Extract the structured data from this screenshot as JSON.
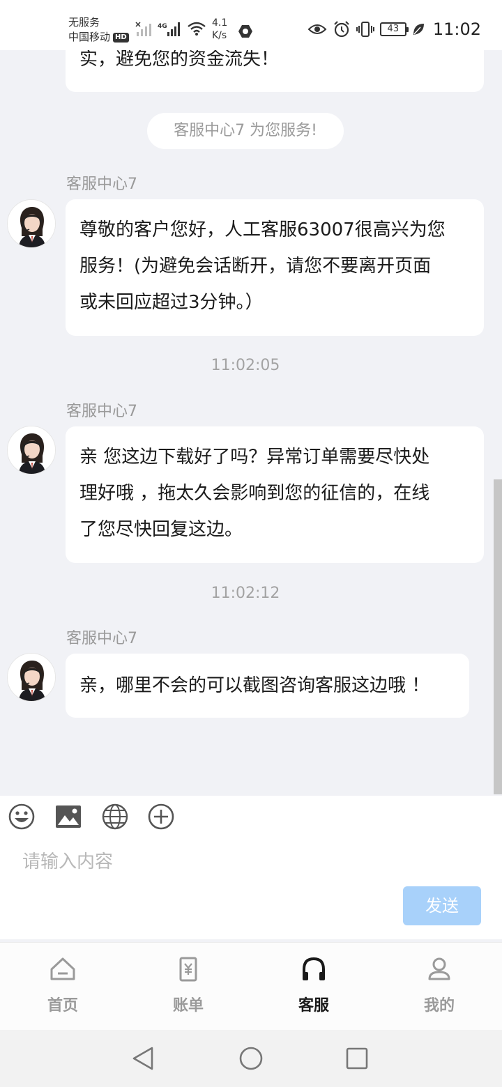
{
  "status_bar": {
    "carrier_line1": "无服务",
    "carrier_line2": "中国移动",
    "hd": "HD",
    "speed_value": "4.1",
    "speed_unit": "K/s",
    "battery": "43",
    "time": "11:02",
    "icons": [
      "signal-icon",
      "signal-4g-icon",
      "wifi-icon",
      "vpn-icon",
      "eye-icon",
      "alarm-icon",
      "vibrate-icon",
      "battery-icon",
      "leaf-icon"
    ]
  },
  "chat": {
    "top_partial_text": "实，避免您的资金流失！",
    "system_message": "客服中心7 为您服务!",
    "messages": [
      {
        "sender": "客服中心7",
        "lines": [
          "尊敬的客户您好，人工客服63007很高兴为您",
          "服务！(为避免会话断开，请您不要离开页面",
          "或未回应超过3分钟。）"
        ]
      },
      {
        "timestamp": "11:02:05",
        "sender": "客服中心7",
        "lines": [
          "亲 您这边下载好了吗？异常订单需要尽快处",
          "理好哦 ，拖太久会影响到您的征信的，在线",
          "了您尽快回复这边。"
        ]
      },
      {
        "timestamp": "11:02:12",
        "sender": "客服中心7",
        "lines": [
          "亲，哪里不会的可以截图咨询客服这边哦 ！"
        ]
      }
    ]
  },
  "input": {
    "placeholder": "请输入内容",
    "send_label": "发送",
    "tools": [
      "emoji-icon",
      "image-icon",
      "globe-icon",
      "plus-icon"
    ]
  },
  "tabbar": {
    "tabs": [
      {
        "label": "首页",
        "icon": "home-icon",
        "active": false
      },
      {
        "label": "账单",
        "icon": "bill-icon",
        "active": false
      },
      {
        "label": "客服",
        "icon": "headset-icon",
        "active": true
      },
      {
        "label": "我的",
        "icon": "user-icon",
        "active": false
      }
    ]
  },
  "colors": {
    "chat_background": "#f1f2f6",
    "bubble": "#ffffff",
    "send_button": "#a8d1fa",
    "active_tab": "#1a1a1a",
    "inactive_tab": "#9a9a9a"
  }
}
